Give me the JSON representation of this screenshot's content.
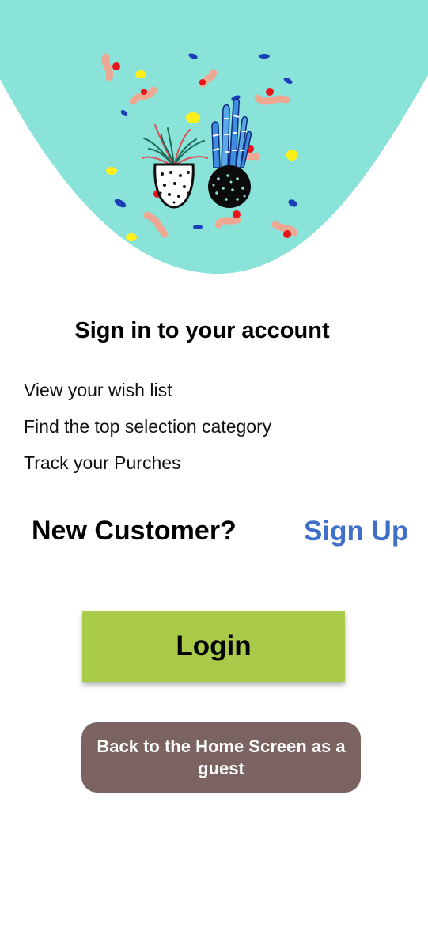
{
  "colors": {
    "hero_background": "#8ae3d8",
    "sign_up_link": "#3f6ecb",
    "login_button": "#aacb4a",
    "guest_button": "#7a6361"
  },
  "hero": {
    "illustration": "two potted plants with confetti"
  },
  "title": "Sign in to your account",
  "features": [
    "View your wish list",
    "Find the top selection category",
    "Track your Purches"
  ],
  "new_customer": {
    "prompt": "New Customer?",
    "sign_up_label": "Sign Up"
  },
  "buttons": {
    "login_label": "Login",
    "guest_label": "Back to the Home Screen as a guest"
  }
}
